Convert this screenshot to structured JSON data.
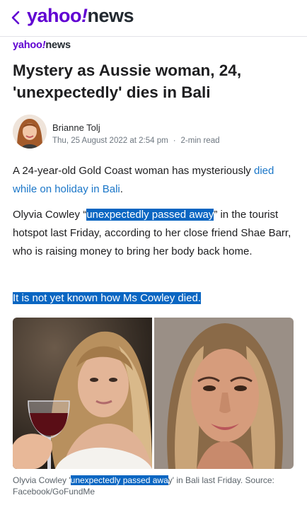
{
  "header": {
    "back_icon": "chevron-left-icon",
    "logo_brand": "yahoo",
    "logo_bang": "!",
    "logo_section": "news"
  },
  "publisher": {
    "brand": "yahoo",
    "bang": "!",
    "section": "news"
  },
  "article": {
    "headline": "Mystery as Aussie woman, 24, 'unexpectedly' dies in Bali",
    "author": "Brianne Tolj",
    "date": "Thu, 25 August 2022 at 2:54 pm",
    "separator": "·",
    "read_time": "2-min read",
    "p1_text": "A 24-year-old Gold Coast woman has mysteriously ",
    "p1_link": "died while on holiday in Bali",
    "p1_end": ".",
    "p2_start": "Olyvia Cowley “",
    "p2_highlight": "unexpectedly passed away",
    "p2_end": "” in the tourist hotspot last Friday, according to her close friend Shae Barr, who is raising money to bring her body back home.",
    "p3_highlight": "It is not yet known how Ms Cowley died.",
    "caption_start": "Olyvia Cowley '",
    "caption_highlight": "unexpectedly passed awa",
    "caption_end": "y' in Bali last Friday. Source: Facebook/GoFundMe"
  },
  "colors": {
    "yahoo_purple": "#6001d2",
    "link_blue": "#1a76c8",
    "selection_blue": "#0a66c2"
  }
}
